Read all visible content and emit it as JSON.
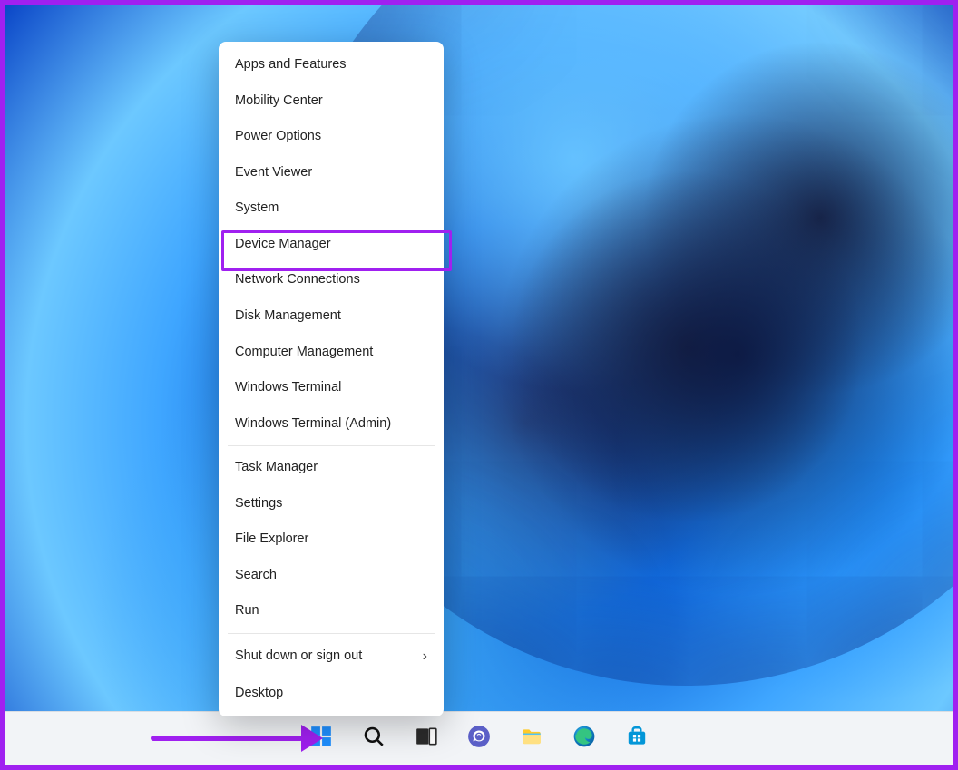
{
  "annotation": {
    "highlighted_item_index": 5,
    "border_color": "#a020f0"
  },
  "winx_menu": {
    "groups": [
      [
        {
          "id": "apps-and-features",
          "label": "Apps and Features"
        },
        {
          "id": "mobility-center",
          "label": "Mobility Center"
        },
        {
          "id": "power-options",
          "label": "Power Options"
        },
        {
          "id": "event-viewer",
          "label": "Event Viewer"
        },
        {
          "id": "system",
          "label": "System"
        },
        {
          "id": "device-manager",
          "label": "Device Manager"
        },
        {
          "id": "network-connections",
          "label": "Network Connections"
        },
        {
          "id": "disk-management",
          "label": "Disk Management"
        },
        {
          "id": "computer-management",
          "label": "Computer Management"
        },
        {
          "id": "windows-terminal",
          "label": "Windows Terminal"
        },
        {
          "id": "windows-terminal-admin",
          "label": "Windows Terminal (Admin)"
        }
      ],
      [
        {
          "id": "task-manager",
          "label": "Task Manager"
        },
        {
          "id": "settings",
          "label": "Settings"
        },
        {
          "id": "file-explorer",
          "label": "File Explorer"
        },
        {
          "id": "search",
          "label": "Search"
        },
        {
          "id": "run",
          "label": "Run"
        }
      ],
      [
        {
          "id": "shut-down-or-sign-out",
          "label": "Shut down or sign out",
          "submenu": true
        },
        {
          "id": "desktop",
          "label": "Desktop"
        }
      ]
    ]
  },
  "taskbar": {
    "icons": [
      {
        "id": "start",
        "name": "start-button",
        "semantic": "windows-logo-icon"
      },
      {
        "id": "search",
        "name": "search-button",
        "semantic": "search-icon"
      },
      {
        "id": "task-view",
        "name": "task-view-button",
        "semantic": "task-view-icon"
      },
      {
        "id": "chat",
        "name": "chat-button",
        "semantic": "chat-icon"
      },
      {
        "id": "file-explorer",
        "name": "file-explorer-button",
        "semantic": "folder-icon"
      },
      {
        "id": "edge",
        "name": "edge-button",
        "semantic": "edge-icon"
      },
      {
        "id": "store",
        "name": "microsoft-store-button",
        "semantic": "store-icon"
      }
    ]
  }
}
